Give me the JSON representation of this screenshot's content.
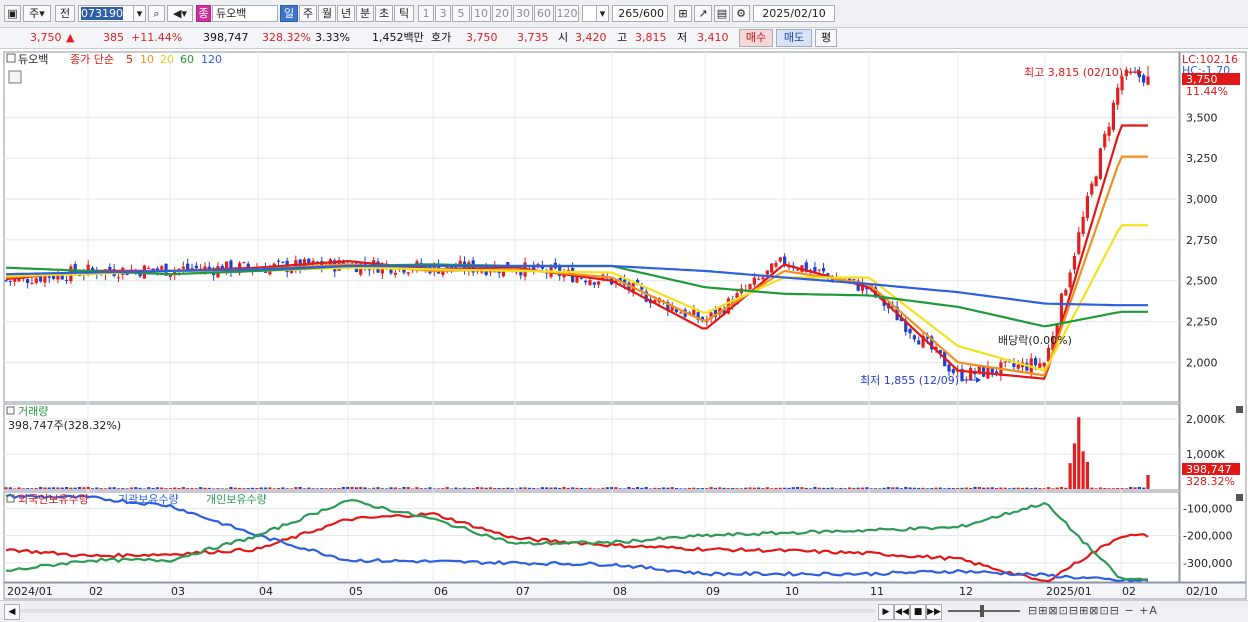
{
  "toolbar": {
    "period_ju": "주",
    "period_jeon": "전",
    "code": "073190",
    "badge": "종",
    "name": "듀오백",
    "btn_day": "일",
    "btn_week": "주",
    "btn_month": "월",
    "btn_year": "년",
    "btn_min": "분",
    "btn_sec": "초",
    "btn_tick": "틱",
    "intervals": [
      "1",
      "3",
      "5",
      "10",
      "20",
      "30",
      "60",
      "120"
    ],
    "count": "265",
    "count_total": "/600",
    "date": "2025/02/10"
  },
  "quote": {
    "price": "3,750",
    "change": "385",
    "change_pct": "+11.44%",
    "volume": "398,747",
    "vol_ratio": "328.32%",
    "turnover": "3.33%",
    "amount": "1,452백만",
    "ask_label": "호가",
    "ask1": "3,750",
    "ask2": "3,735",
    "open_label": "시",
    "open": "3,420",
    "high_label": "고",
    "high": "3,815",
    "low_label": "저",
    "low": "3,410",
    "buy": "매수",
    "sell": "매도",
    "eval": "평"
  },
  "legend": {
    "stock": "듀오백",
    "close_label": "종가 단순",
    "ma5": "5",
    "ma10": "10",
    "ma20": "20",
    "ma60": "60",
    "ma120": "120"
  },
  "price_axis": {
    "lc": "LC:102.16",
    "hc": "HC:-1.70",
    "last": "3,750",
    "last_pct": "11.44%",
    "ticks": [
      "3,500",
      "3,250",
      "3,000",
      "2,750",
      "2,500",
      "2,250",
      "2,000"
    ]
  },
  "annotations": {
    "high": "최고 3,815 (02/10)",
    "low": "최저 1,855 (12/09)",
    "dividend": "배당락(0.00%)"
  },
  "volume_panel": {
    "title": "거래량",
    "value": "398,747주(328.32%)",
    "ticks": [
      "2,000K",
      "1,000K"
    ],
    "last": "398,747",
    "last_pct": "328.32%"
  },
  "holdings_panel": {
    "foreign": "외국인보유수량",
    "inst": "기관보유수량",
    "indiv": "개인보유수량",
    "ticks": [
      "-100,000",
      "-200,000",
      "-300,000"
    ]
  },
  "date_axis": [
    "2024/01",
    "02",
    "03",
    "04",
    "05",
    "06",
    "07",
    "08",
    "09",
    "10",
    "11",
    "12",
    "2025/01",
    "02"
  ],
  "date_axis_end": "02/10",
  "colors": {
    "up": "#e02020",
    "down": "#1f3fd0",
    "ma5": "#e01818",
    "ma10": "#f0901e",
    "ma20": "#f5e21a",
    "ma60": "#1f9a3a",
    "ma120": "#2e5fe0",
    "foreign": "#e01818",
    "inst": "#2e5fe0",
    "indiv": "#2f9a55"
  },
  "chart_data": {
    "type": "line",
    "x": [
      "2024/01",
      "02",
      "03",
      "04",
      "05",
      "06",
      "07",
      "08",
      "09",
      "10",
      "11",
      "12",
      "2025/01",
      "02/10"
    ],
    "series": [
      {
        "name": "종가",
        "values": [
          2500,
          2560,
          2570,
          2580,
          2600,
          2580,
          2580,
          2500,
          2250,
          2620,
          2450,
          1920,
          2000,
          3750
        ]
      },
      {
        "name": "5",
        "values": [
          2510,
          2560,
          2560,
          2580,
          2620,
          2570,
          2580,
          2500,
          2200,
          2600,
          2460,
          1950,
          1900,
          3450
        ]
      },
      {
        "name": "10",
        "values": [
          2520,
          2550,
          2560,
          2570,
          2600,
          2560,
          2570,
          2520,
          2250,
          2560,
          2480,
          2000,
          1920,
          3260
        ]
      },
      {
        "name": "20",
        "values": [
          2530,
          2540,
          2560,
          2560,
          2580,
          2570,
          2560,
          2550,
          2300,
          2520,
          2520,
          2100,
          1950,
          2840
        ]
      },
      {
        "name": "60",
        "values": [
          2580,
          2560,
          2540,
          2560,
          2590,
          2600,
          2590,
          2590,
          2460,
          2420,
          2410,
          2340,
          2220,
          2310
        ]
      },
      {
        "name": "120",
        "values": [
          2540,
          2550,
          2560,
          2570,
          2590,
          2590,
          2590,
          2590,
          2560,
          2520,
          2480,
          2430,
          2360,
          2350
        ]
      }
    ],
    "ylim": [
      1855,
      3815
    ],
    "high": 3815,
    "low": 1855,
    "last": 3750
  }
}
